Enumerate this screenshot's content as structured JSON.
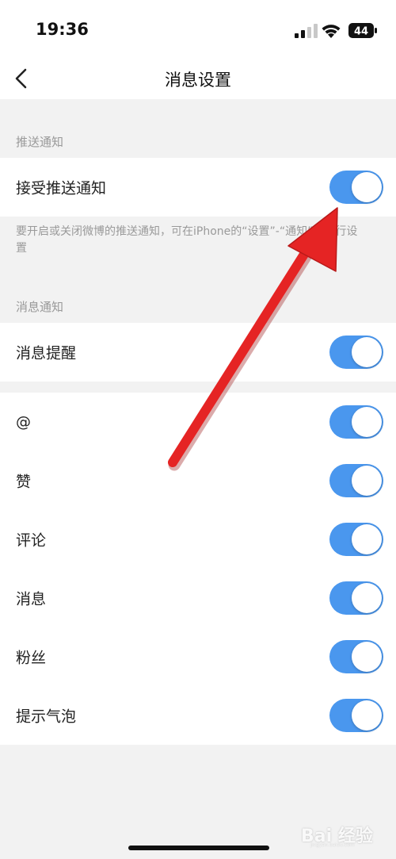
{
  "status_bar": {
    "time": "19:36",
    "battery": "44"
  },
  "nav": {
    "title": "消息设置"
  },
  "sections": {
    "push": {
      "header": "推送通知",
      "items": [
        {
          "label": "接受推送通知",
          "enabled": true
        }
      ],
      "hint": "要开启或关闭微博的推送通知，可在iPhone的“设置”-“通知”中进行设置"
    },
    "message": {
      "header": "消息通知",
      "items": [
        {
          "label": "消息提醒",
          "enabled": true
        }
      ]
    },
    "types": {
      "items": [
        {
          "label": "@",
          "enabled": true
        },
        {
          "label": "赞",
          "enabled": true
        },
        {
          "label": "评论",
          "enabled": true
        },
        {
          "label": "消息",
          "enabled": true
        },
        {
          "label": "粉丝",
          "enabled": true
        },
        {
          "label": "提示气泡",
          "enabled": true
        }
      ]
    }
  },
  "colors": {
    "toggle_on": "#4a97ee",
    "annotation_arrow": "#e52424"
  },
  "watermark": {
    "text": "Bai 经验",
    "sub": "jingyan.baidu.com"
  }
}
